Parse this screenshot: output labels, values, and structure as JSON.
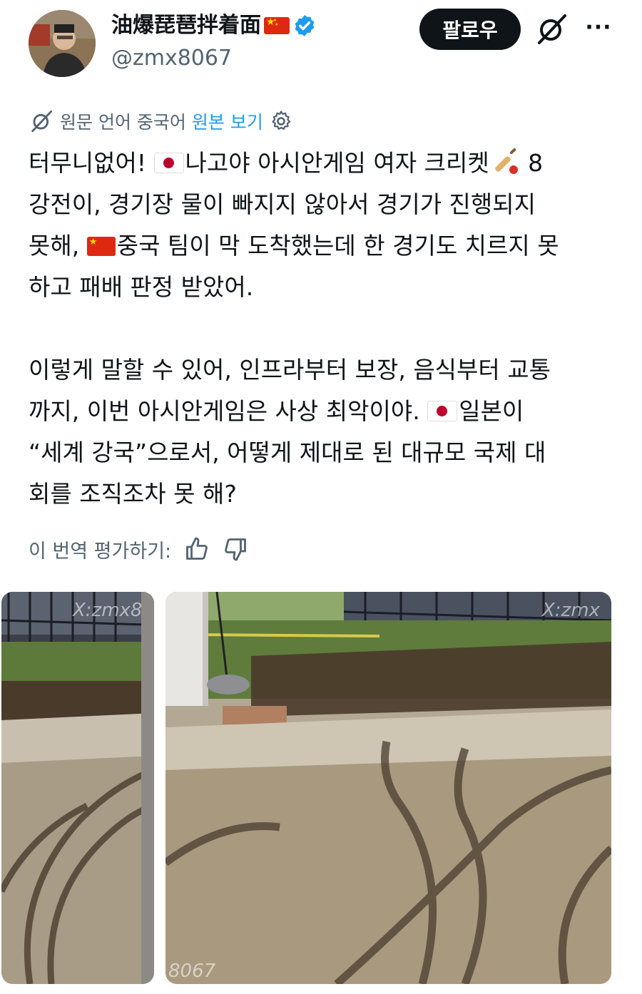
{
  "author": {
    "display_name": "油爆琵琶拌着面",
    "handle": "@zmx8067"
  },
  "actions": {
    "follow_label": "팔로우",
    "more_label": "···"
  },
  "translation_bar": {
    "source_text": "원문 언어 중국어",
    "show_original_label": "원본 보기"
  },
  "post": {
    "p1_a": "터무니없어! ",
    "p1_b": "나고야 아시안게임 여자 크리켓",
    "p1_c": " 8\n강전이, 경기장 물이 빠지지 않아서 경기가 진행되지\n못해, ",
    "p1_d": "중국 팀이 막 도착했는데 한 경기도 치르지 못\n하고 패배 판정 받았어.",
    "p2_a": "이렇게 말할 수 있어, 인프라부터 보장, 음식부터 교통\n까지, 이번 아시안게임은 사상 최악이야. ",
    "p2_b": "일본이\n“세계 강국”으로서, 어떻게 제대로 된 대규모 국제 대\n회를 조직조차 못 해?"
  },
  "rating": {
    "label": "이 번역 평가하기:"
  },
  "media": {
    "left_watermark": "X:zmx8",
    "right_watermark": "X:zmx",
    "bottom_watermark": "8067"
  },
  "colors": {
    "follow_bg": "#0f1419",
    "link": "#1d9bf0",
    "secondary_text": "#536471",
    "verified": "#1d9bf0"
  }
}
